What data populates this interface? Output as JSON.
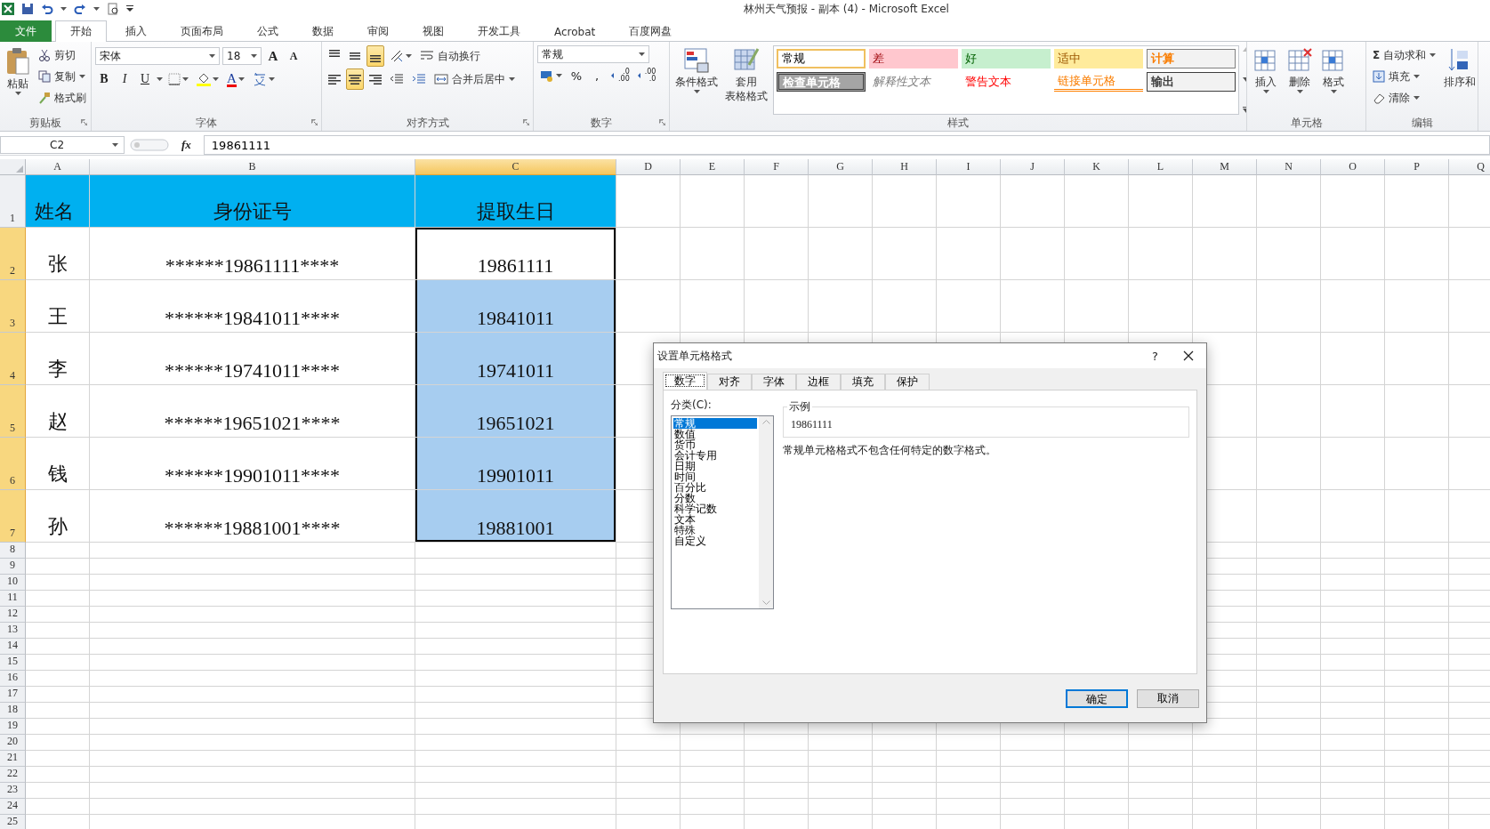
{
  "window": {
    "title": "林州天气预报 - 副本 (4)  -  Microsoft Excel"
  },
  "ribbon": {
    "tabs": [
      {
        "label": "文件",
        "kind": "file",
        "selected": false
      },
      {
        "label": "开始",
        "kind": "tab",
        "selected": true
      },
      {
        "label": "插入",
        "kind": "tab",
        "selected": false
      },
      {
        "label": "页面布局",
        "kind": "tab",
        "selected": false
      },
      {
        "label": "公式",
        "kind": "tab",
        "selected": false
      },
      {
        "label": "数据",
        "kind": "tab",
        "selected": false
      },
      {
        "label": "审阅",
        "kind": "tab",
        "selected": false
      },
      {
        "label": "视图",
        "kind": "tab",
        "selected": false
      },
      {
        "label": "开发工具",
        "kind": "tab",
        "selected": false
      },
      {
        "label": "Acrobat",
        "kind": "tab",
        "selected": false
      },
      {
        "label": "百度网盘",
        "kind": "tab",
        "selected": false
      }
    ],
    "clipboard": {
      "paste": "粘贴",
      "cut": "剪切",
      "copy": "复制",
      "painter": "格式刷",
      "label": "剪贴板"
    },
    "font": {
      "name": "宋体",
      "size": "18",
      "grow": "A",
      "shrink": "A",
      "styles": [
        "B",
        "I",
        "U"
      ],
      "color_letter": "A",
      "label": "字体"
    },
    "alignment": {
      "vertical": [
        {
          "kind": "top",
          "selected": false
        },
        {
          "kind": "middle",
          "selected": false
        },
        {
          "kind": "bottom",
          "selected": true
        }
      ],
      "horizontal": [
        {
          "kind": "left",
          "selected": false
        },
        {
          "kind": "center",
          "selected": true
        },
        {
          "kind": "right",
          "selected": false
        }
      ],
      "wrap": "自动换行",
      "merge": "合并后居中",
      "label": "对齐方式"
    },
    "number": {
      "format": "常规",
      "percent": "%",
      "comma": ",",
      "decimals": [
        {
          "top": ".0",
          "bottom": ".00"
        },
        {
          "top": ".00",
          "bottom": ".0"
        }
      ],
      "label": "数字"
    },
    "styles": {
      "conditional": "条件格式",
      "table": [
        "套用",
        "表格格式"
      ],
      "gallery": [
        {
          "label": "常规",
          "kind": "normal"
        },
        {
          "label": "差",
          "kind": "bad"
        },
        {
          "label": "好",
          "kind": "good"
        },
        {
          "label": "适中",
          "kind": "neutral"
        },
        {
          "label": "计算",
          "kind": "calculation"
        },
        {
          "label": "检查单元格",
          "kind": "check"
        },
        {
          "label": "解释性文本",
          "kind": "explanatory"
        },
        {
          "label": "警告文本",
          "kind": "warning"
        },
        {
          "label": "链接单元格",
          "kind": "linked"
        },
        {
          "label": "输出",
          "kind": "output"
        }
      ],
      "label": "样式"
    },
    "cells": {
      "buttons": [
        "插入",
        "删除",
        "格式"
      ],
      "label": "单元格"
    },
    "editing": {
      "sum_symbol": "Σ",
      "autosum": "自动求和",
      "fill": "填充",
      "clear": "清除",
      "sort": "排序和",
      "label": "编辑"
    }
  },
  "formula_bar": {
    "name_box": "C2",
    "fx": "fx",
    "value": "19861111"
  },
  "sheet": {
    "columns": [
      {
        "label": "A",
        "selected": false
      },
      {
        "label": "B",
        "selected": false
      },
      {
        "label": "C",
        "selected": true
      },
      {
        "label": "D",
        "selected": false
      },
      {
        "label": "E",
        "selected": false
      },
      {
        "label": "F",
        "selected": false
      },
      {
        "label": "G",
        "selected": false
      },
      {
        "label": "H",
        "selected": false
      },
      {
        "label": "I",
        "selected": false
      },
      {
        "label": "J",
        "selected": false
      },
      {
        "label": "K",
        "selected": false
      },
      {
        "label": "L",
        "selected": false
      },
      {
        "label": "M",
        "selected": false
      },
      {
        "label": "N",
        "selected": false
      },
      {
        "label": "O",
        "selected": false
      },
      {
        "label": "P",
        "selected": false
      },
      {
        "label": "Q",
        "selected": false
      }
    ],
    "rows": [
      {
        "number": "1",
        "kind": "header",
        "selected": false,
        "cells": [
          {
            "text": "姓名",
            "selected": false
          },
          {
            "text": "身份证号",
            "selected": false
          },
          {
            "text": "提取生日",
            "selected": false
          }
        ]
      },
      {
        "number": "2",
        "kind": "data",
        "selected": true,
        "cells": [
          {
            "text": "张",
            "selected": false
          },
          {
            "text": "******19861111****",
            "selected": false
          },
          {
            "text": "19861111",
            "selected": true
          }
        ]
      },
      {
        "number": "3",
        "kind": "data",
        "selected": true,
        "cells": [
          {
            "text": "王",
            "selected": false
          },
          {
            "text": "******19841011****",
            "selected": false
          },
          {
            "text": "19841011",
            "selected": true
          }
        ]
      },
      {
        "number": "4",
        "kind": "data",
        "selected": true,
        "cells": [
          {
            "text": "李",
            "selected": false
          },
          {
            "text": "******19741011****",
            "selected": false
          },
          {
            "text": "19741011",
            "selected": true
          }
        ]
      },
      {
        "number": "5",
        "kind": "data",
        "selected": true,
        "cells": [
          {
            "text": "赵",
            "selected": false
          },
          {
            "text": "******19651021****",
            "selected": false
          },
          {
            "text": "19651021",
            "selected": true
          }
        ]
      },
      {
        "number": "6",
        "kind": "data",
        "selected": true,
        "cells": [
          {
            "text": "钱",
            "selected": false
          },
          {
            "text": "******19901011****",
            "selected": false
          },
          {
            "text": "19901011",
            "selected": true
          }
        ]
      },
      {
        "number": "7",
        "kind": "data",
        "selected": true,
        "cells": [
          {
            "text": "孙",
            "selected": false
          },
          {
            "text": "******19881001****",
            "selected": false
          },
          {
            "text": "19881001",
            "selected": true
          }
        ]
      }
    ],
    "empty_rows": [
      "8",
      "9",
      "10",
      "11",
      "12",
      "13",
      "14",
      "15",
      "16",
      "17",
      "18",
      "19",
      "20",
      "21",
      "22",
      "23",
      "24",
      "25"
    ]
  },
  "dialog": {
    "title": "设置单元格格式",
    "help": "?",
    "tabs": [
      {
        "label": "数字",
        "selected": true
      },
      {
        "label": "对齐",
        "selected": false
      },
      {
        "label": "字体",
        "selected": false
      },
      {
        "label": "边框",
        "selected": false
      },
      {
        "label": "填充",
        "selected": false
      },
      {
        "label": "保护",
        "selected": false
      }
    ],
    "category_label": "分类(C):",
    "categories": [
      {
        "label": "常规",
        "selected": true
      },
      {
        "label": "数值",
        "selected": false
      },
      {
        "label": "货币",
        "selected": false
      },
      {
        "label": "会计专用",
        "selected": false
      },
      {
        "label": "日期",
        "selected": false
      },
      {
        "label": "时间",
        "selected": false
      },
      {
        "label": "百分比",
        "selected": false
      },
      {
        "label": "分数",
        "selected": false
      },
      {
        "label": "科学记数",
        "selected": false
      },
      {
        "label": "文本",
        "selected": false
      },
      {
        "label": "特殊",
        "selected": false
      },
      {
        "label": "自定义",
        "selected": false
      }
    ],
    "sample_label": "示例",
    "sample_value": "19861111",
    "description": "常规单元格格式不包含任何特定的数字格式。",
    "buttons": [
      {
        "label": "确定",
        "kind": "default"
      },
      {
        "label": "取消",
        "kind": "normal"
      }
    ]
  }
}
